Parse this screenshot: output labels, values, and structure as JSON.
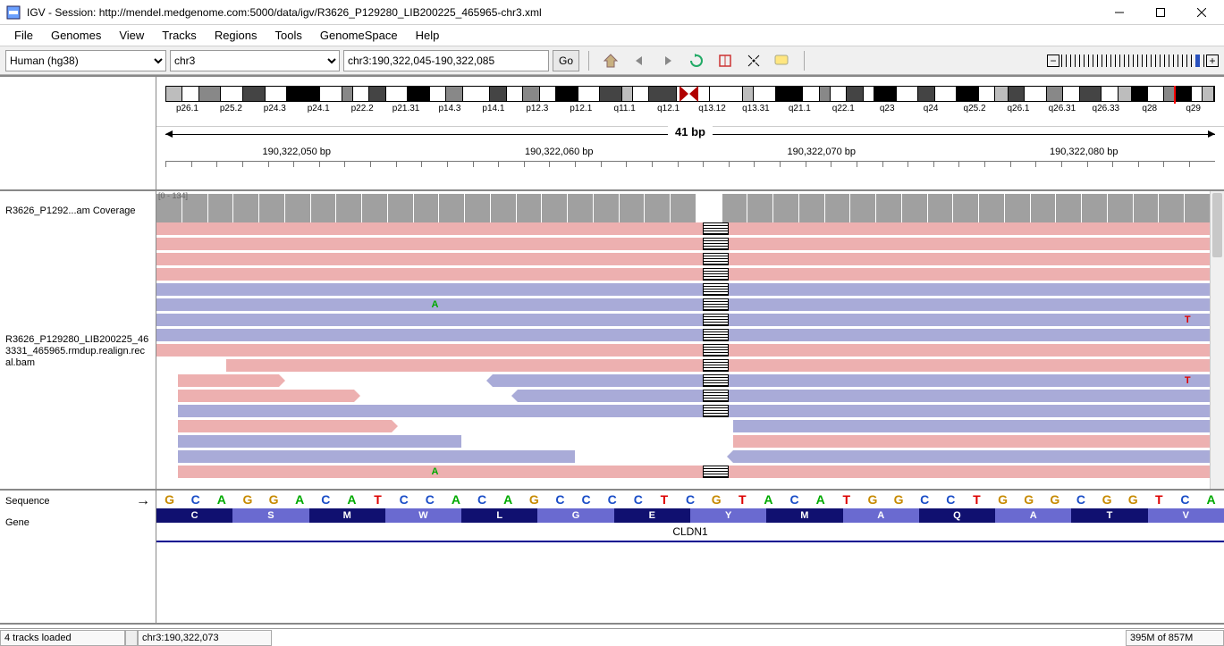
{
  "window": {
    "title": "IGV - Session: http://mendel.medgenome.com:5000/data/igv/R3626_P129280_LIB200225_465965-chr3.xml"
  },
  "menu": [
    "File",
    "Genomes",
    "View",
    "Tracks",
    "Regions",
    "Tools",
    "GenomeSpace",
    "Help"
  ],
  "toolbar": {
    "genome": "Human (hg38)",
    "chromosome": "chr3",
    "locus": "chr3:190,322,045-190,322,085",
    "go_label": "Go"
  },
  "ideogram": {
    "bands": [
      {
        "c": "l",
        "w": 1.5
      },
      {
        "c": "w",
        "w": 1.5
      },
      {
        "c": "m",
        "w": 2
      },
      {
        "c": "w",
        "w": 2
      },
      {
        "c": "d",
        "w": 2
      },
      {
        "c": "w",
        "w": 2
      },
      {
        "c": "k",
        "w": 3
      },
      {
        "c": "w",
        "w": 2
      },
      {
        "c": "m",
        "w": 1
      },
      {
        "c": "w",
        "w": 1.5
      },
      {
        "c": "d",
        "w": 1.5
      },
      {
        "c": "w",
        "w": 2
      },
      {
        "c": "k",
        "w": 2
      },
      {
        "c": "w",
        "w": 1.5
      },
      {
        "c": "m",
        "w": 1.5
      },
      {
        "c": "w",
        "w": 2.5
      },
      {
        "c": "d",
        "w": 1.5
      },
      {
        "c": "w",
        "w": 1.5
      },
      {
        "c": "m",
        "w": 1.5
      },
      {
        "c": "w",
        "w": 1.5
      },
      {
        "c": "k",
        "w": 2
      },
      {
        "c": "w",
        "w": 2
      },
      {
        "c": "d",
        "w": 2
      },
      {
        "c": "l",
        "w": 1
      },
      {
        "c": "w",
        "w": 1.5
      },
      {
        "c": "d",
        "w": 2.5
      },
      {
        "c": "w",
        "w": 3
      },
      {
        "c": "w",
        "w": 3
      },
      {
        "c": "l",
        "w": 1
      },
      {
        "c": "w",
        "w": 2
      },
      {
        "c": "k",
        "w": 2.5
      },
      {
        "c": "w",
        "w": 1.5
      },
      {
        "c": "m",
        "w": 1
      },
      {
        "c": "w",
        "w": 1.5
      },
      {
        "c": "d",
        "w": 1.5
      },
      {
        "c": "w",
        "w": 1
      },
      {
        "c": "k",
        "w": 2
      },
      {
        "c": "w",
        "w": 2
      },
      {
        "c": "d",
        "w": 1.5
      },
      {
        "c": "w",
        "w": 2
      },
      {
        "c": "k",
        "w": 2
      },
      {
        "c": "w",
        "w": 1.5
      },
      {
        "c": "l",
        "w": 1.2
      },
      {
        "c": "d",
        "w": 1.5
      },
      {
        "c": "w",
        "w": 2
      },
      {
        "c": "m",
        "w": 1.5
      },
      {
        "c": "w",
        "w": 1.5
      },
      {
        "c": "d",
        "w": 2
      },
      {
        "c": "w",
        "w": 1.5
      },
      {
        "c": "l",
        "w": 1.2
      },
      {
        "c": "k",
        "w": 1.5
      },
      {
        "c": "w",
        "w": 1.5
      },
      {
        "c": "m",
        "w": 1
      },
      {
        "c": "k",
        "w": 1.5
      },
      {
        "c": "w",
        "w": 1
      },
      {
        "c": "l",
        "w": 1
      }
    ],
    "labels": [
      "p26.1",
      "p25.2",
      "p24.3",
      "p24.1",
      "p22.2",
      "p21.31",
      "p14.3",
      "p14.1",
      "p12.3",
      "p12.1",
      "q11.1",
      "q12.1",
      "q13.12",
      "q13.31",
      "q21.1",
      "q22.1",
      "q23",
      "q24",
      "q25.2",
      "q26.1",
      "q26.31",
      "q26.33",
      "q28",
      "q29"
    ],
    "marker_pct": 96.2
  },
  "ruler": {
    "span": "41 bp",
    "ticks": [
      "190,322,050 bp",
      "190,322,060 bp",
      "190,322,070 bp",
      "190,322,080 bp"
    ]
  },
  "tracks": {
    "coverage_name": "R3626_P1292...am Coverage",
    "coverage_range": "[0 - 134]",
    "bam_name": "R3626_P129280_LIB200225_463331_465965.rmdup.realign.recal.bam",
    "del_left_pct": 51.2,
    "del_width_pct": 2.4,
    "reads": [
      {
        "strand": "fwd",
        "l": 0,
        "r": 100
      },
      {
        "strand": "fwd",
        "l": 0,
        "r": 100
      },
      {
        "strand": "fwd",
        "l": 0,
        "r": 100
      },
      {
        "strand": "fwd",
        "l": 0,
        "r": 100
      },
      {
        "strand": "rev",
        "l": 0,
        "r": 100
      },
      {
        "strand": "rev",
        "l": 0,
        "r": 100,
        "snps": [
          {
            "pos": 25.5,
            "b": "A"
          }
        ]
      },
      {
        "strand": "rev",
        "l": 0,
        "r": 100,
        "snps": [
          {
            "pos": 96,
            "b": "T"
          }
        ]
      },
      {
        "strand": "rev",
        "l": 0,
        "r": 100
      },
      {
        "strand": "fwd",
        "l": 0,
        "r": 100
      },
      {
        "strand": "fwd",
        "l": 6.5,
        "r": 100
      },
      {
        "strand": "twoPart",
        "parts": [
          {
            "s": "fwd",
            "l": 2,
            "r": 11.5,
            "ar": true
          },
          {
            "s": "rev",
            "l": 31.5,
            "r": 100,
            "al": true,
            "snps": [
              {
                "pos": 96,
                "b": "T"
              }
            ]
          }
        ]
      },
      {
        "strand": "twoPart",
        "parts": [
          {
            "s": "fwd",
            "l": 2,
            "r": 18.5,
            "ar": true
          },
          {
            "s": "rev",
            "l": 33.8,
            "r": 100,
            "al": true
          }
        ]
      },
      {
        "strand": "rev",
        "l": 2,
        "r": 100
      },
      {
        "strand": "twoPart",
        "parts": [
          {
            "s": "fwd",
            "l": 2,
            "r": 22,
            "ar": true
          },
          {
            "s": "rev",
            "l": 54,
            "r": 100
          }
        ]
      },
      {
        "strand": "twoPart",
        "parts": [
          {
            "s": "rev",
            "l": 2,
            "r": 28.6
          },
          {
            "s": "fwd",
            "l": 54,
            "r": 100
          }
        ]
      },
      {
        "strand": "twoPart",
        "parts": [
          {
            "s": "rev",
            "l": 2,
            "r": 39.2
          },
          {
            "s": "rev",
            "l": 54,
            "r": 100,
            "al": true
          }
        ]
      },
      {
        "strand": "fwd",
        "l": 2,
        "r": 100,
        "snps": [
          {
            "pos": 25.5,
            "b": "A"
          }
        ]
      }
    ]
  },
  "sequence": {
    "label": "Sequence",
    "gene_label": "Gene",
    "bases": [
      "G",
      "C",
      "A",
      "G",
      "G",
      "A",
      "C",
      "A",
      "T",
      "C",
      "C",
      "A",
      "C",
      "A",
      "G",
      "C",
      "C",
      "C",
      "C",
      "T",
      "C",
      "G",
      "T",
      "A",
      "C",
      "A",
      "T",
      "G",
      "G",
      "C",
      "C",
      "T",
      "G",
      "G",
      "G",
      "C",
      "G",
      "G",
      "T",
      "C",
      "A"
    ],
    "aa": [
      {
        "l": "C",
        "c": "d"
      },
      {
        "l": "S",
        "c": "l"
      },
      {
        "l": "M",
        "c": "d"
      },
      {
        "l": "W",
        "c": "l"
      },
      {
        "l": "L",
        "c": "d"
      },
      {
        "l": "G",
        "c": "l"
      },
      {
        "l": "E",
        "c": "d"
      },
      {
        "l": "Y",
        "c": "l"
      },
      {
        "l": "M",
        "c": "d"
      },
      {
        "l": "A",
        "c": "l"
      },
      {
        "l": "Q",
        "c": "d"
      },
      {
        "l": "A",
        "c": "l"
      },
      {
        "l": "T",
        "c": "d"
      },
      {
        "l": "V",
        "c": "l"
      }
    ],
    "gene_name": "CLDN1"
  },
  "status": {
    "left": "4 tracks loaded",
    "pos": "chr3:190,322,073",
    "mem": "395M of 857M"
  },
  "colors": {
    "fwd": "#edb0b0",
    "rev": "#a9abd8",
    "cov": "#a0a0a0"
  }
}
